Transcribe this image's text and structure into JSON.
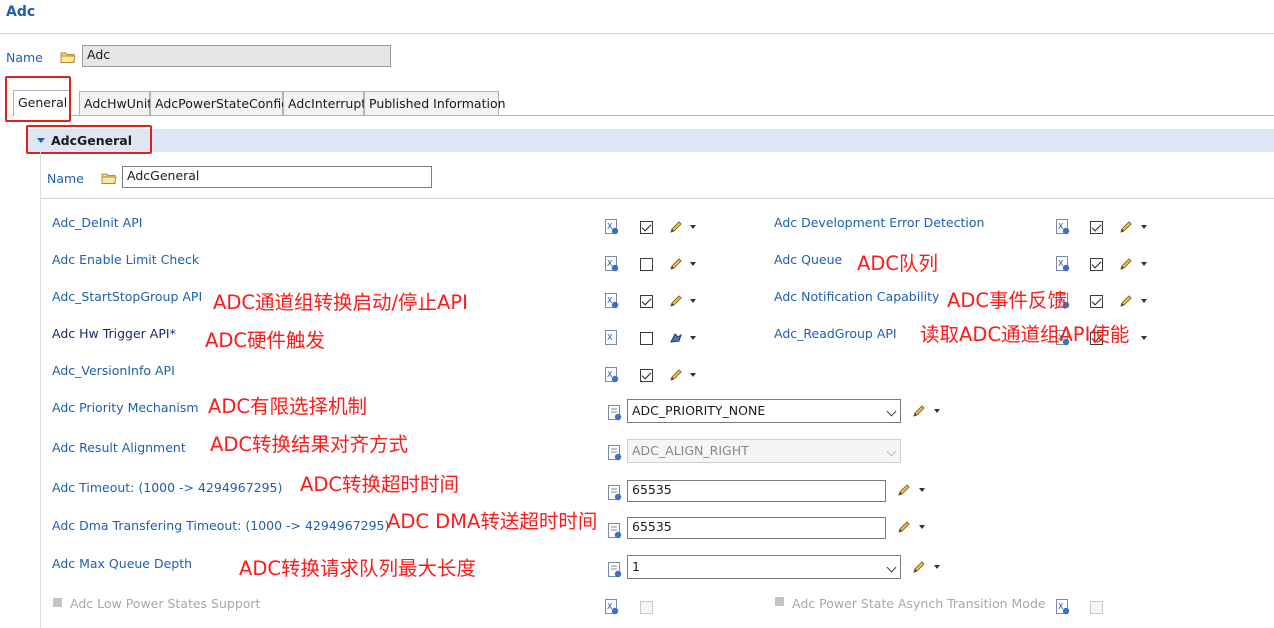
{
  "header": {
    "title": "Adc"
  },
  "name_row": {
    "label": "Name",
    "value": "Adc"
  },
  "tabs": [
    {
      "label": "General"
    },
    {
      "label": "AdcHwUnit"
    },
    {
      "label": "AdcPowerStateConfig"
    },
    {
      "label": "AdcInterrupt"
    },
    {
      "label": "Published Information"
    }
  ],
  "section": {
    "title": "AdcGeneral",
    "name_label": "Name",
    "name_value": "AdcGeneral"
  },
  "params": {
    "deinit": {
      "label": "Adc_DeInit API",
      "checked": true
    },
    "dev_error": {
      "label": "Adc Development Error Detection",
      "checked": true
    },
    "limit_check": {
      "label": "Adc Enable Limit Check",
      "checked": false
    },
    "queue": {
      "label": "Adc Queue",
      "checked": true
    },
    "startstop": {
      "label": "Adc_StartStopGroup API",
      "checked": true
    },
    "notif": {
      "label": "Adc Notification Capability",
      "checked": true
    },
    "hw_trigger": {
      "label": "Adc Hw Trigger  API*",
      "checked": false
    },
    "readgroup": {
      "label": "Adc_ReadGroup API",
      "checked": true
    },
    "versioninfo": {
      "label": "Adc_VersionInfo API",
      "checked": true
    },
    "priority": {
      "label": "Adc Priority Mechanism",
      "value": "ADC_PRIORITY_NONE"
    },
    "alignment": {
      "label": "Adc Result Alignment",
      "value": "ADC_ALIGN_RIGHT"
    },
    "timeout": {
      "label": "Adc Timeout: (1000 -> 4294967295)",
      "value": "65535"
    },
    "dma_timeout": {
      "label": "Adc Dma Transfering Timeout: (1000 -> 4294967295)",
      "value": "65535"
    },
    "max_queue": {
      "label": "Adc Max Queue Depth",
      "value": "1"
    },
    "low_power": {
      "label": "Adc Low Power States Support"
    },
    "power_async": {
      "label": "Adc Power State Asynch Transition Mode"
    }
  },
  "annotations": {
    "queue": "ADC队列",
    "startstop": "ADC通道组转换启动/停止API",
    "notif": "ADC事件反馈",
    "hw_trigger": "ADC硬件触发",
    "readgroup": "读取ADC通道组API使能",
    "priority": "ADC有限选择机制",
    "alignment": "ADC转换结果对齐方式",
    "timeout": "ADC转换超时时间",
    "dma_timeout": "ADC DMA转送超时时间",
    "max_queue": "ADC转换请求队列最大长度"
  },
  "colors": {
    "link": "#1f5fad",
    "annotation": "#ff1a1a",
    "section_bar": "#dde6f2",
    "highlight_box": "#e0201a"
  }
}
